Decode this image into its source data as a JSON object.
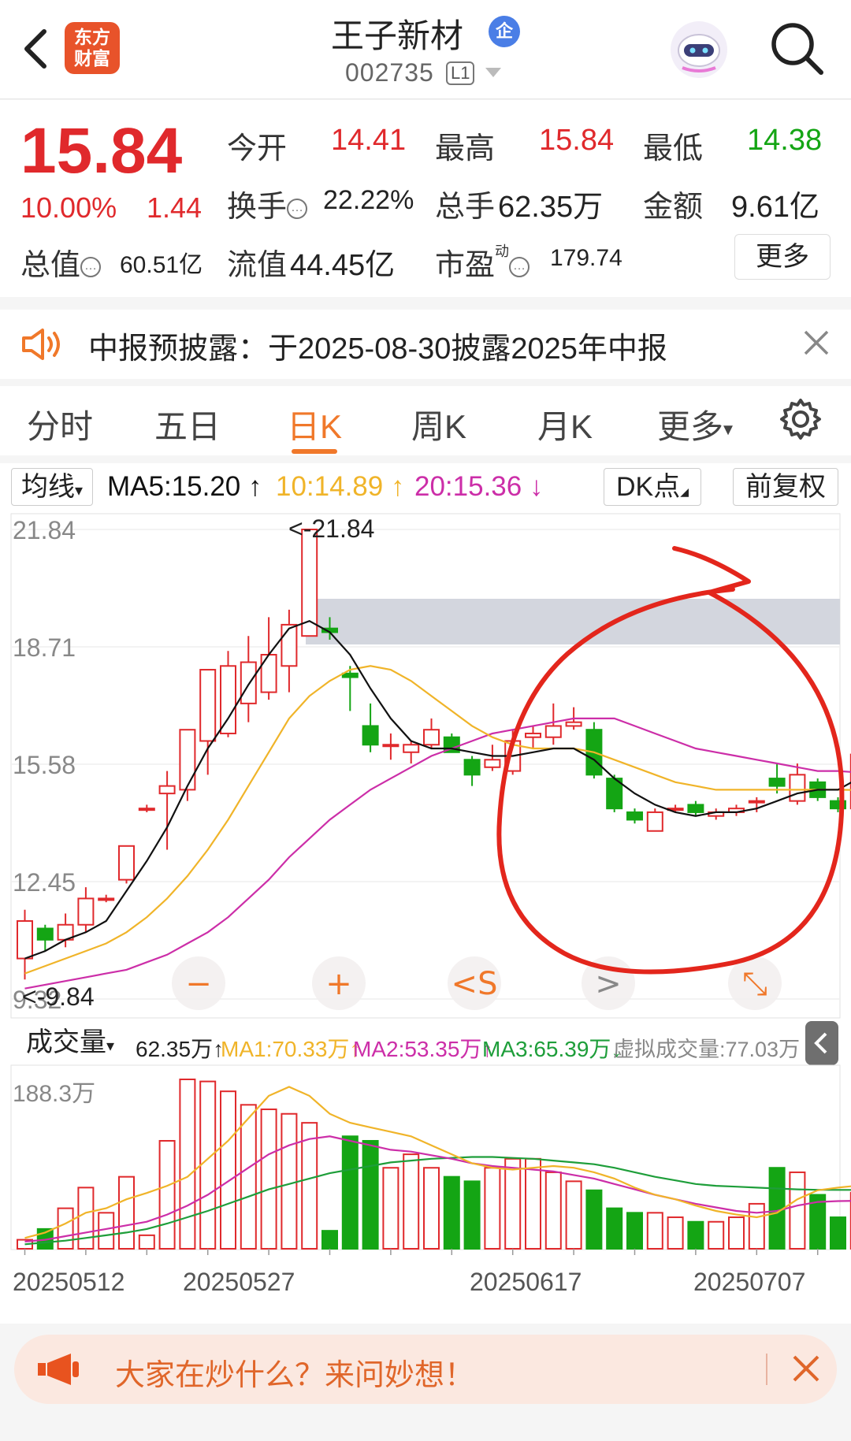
{
  "header": {
    "logo_line1": "东方",
    "logo_line2": "财富",
    "stock_name": "王子新材",
    "badge": "企",
    "stock_code": "002735",
    "level_badge": "L1"
  },
  "quote": {
    "price": "15.84",
    "change_pct": "10.00%",
    "change_amt": "1.44",
    "open_label": "今开",
    "open_value": "14.41",
    "high_label": "最高",
    "high_value": "15.84",
    "low_label": "最低",
    "low_value": "14.38",
    "turnover_label": "换手",
    "turnover_value": "22.22%",
    "volume_label": "总手",
    "volume_value": "62.35万",
    "amount_label": "金额",
    "amount_value": "9.61亿",
    "mcap_label": "总值",
    "mcap_value": "60.51亿",
    "float_label": "流值",
    "float_value": "44.45亿",
    "pe_label": "市盈",
    "pe_super": "动",
    "pe_value": "179.74",
    "more_button": "更多"
  },
  "notice": {
    "text": "中报预披露：于2025-08-30披露2025年中报"
  },
  "tabs": [
    "分时",
    "五日",
    "日K",
    "周K",
    "月K",
    "更多"
  ],
  "active_tab": "日K",
  "ma_bar": {
    "select_label": "均线",
    "ma5": "MA5:15.20",
    "ma10": "10:14.89",
    "ma20": "20:15.36",
    "dk_button": "DK点",
    "adjust_button": "前复权"
  },
  "volume_bar": {
    "select_label": "成交量",
    "vol": "62.35万",
    "ma1": "MA1:70.33万",
    "ma2": "MA2:53.35万",
    "ma3": "MA3:65.39万",
    "virtual": "虚拟成交量:77.03万"
  },
  "colors": {
    "up": "#e0292c",
    "down": "#14a514",
    "ma5": "#111111",
    "ma10": "#f0b429",
    "ma20": "#cc2ea8",
    "vol_ma3": "#1e9e3a",
    "accent": "#f0782a"
  },
  "chart_data": {
    "type": "candlestick",
    "y_ticks": [
      "21.84",
      "18.71",
      "15.58",
      "12.45",
      "9.32"
    ],
    "max_marker": "<-21.84",
    "min_marker": "<-9.84",
    "volume_max_label": "188.3万",
    "x_labels": [
      "20250512",
      "20250527",
      "20250617",
      "20250707"
    ],
    "candles": [
      {
        "o": 10.4,
        "c": 11.4,
        "h": 11.7,
        "l": 9.84
      },
      {
        "o": 11.2,
        "c": 10.9,
        "h": 11.3,
        "l": 10.6
      },
      {
        "o": 10.9,
        "c": 11.3,
        "h": 11.6,
        "l": 10.7
      },
      {
        "o": 11.3,
        "c": 12.0,
        "h": 12.3,
        "l": 11.1
      },
      {
        "o": 12.0,
        "c": 12.0,
        "h": 12.1,
        "l": 11.9
      },
      {
        "o": 12.5,
        "c": 13.4,
        "h": 13.4,
        "l": 12.4
      },
      {
        "o": 14.4,
        "c": 14.4,
        "h": 14.5,
        "l": 14.3
      },
      {
        "o": 14.8,
        "c": 15.0,
        "h": 15.4,
        "l": 13.3
      },
      {
        "o": 14.9,
        "c": 16.5,
        "h": 16.5,
        "l": 14.6
      },
      {
        "o": 16.2,
        "c": 18.1,
        "h": 18.1,
        "l": 15.3
      },
      {
        "o": 16.4,
        "c": 18.2,
        "h": 18.6,
        "l": 16.3
      },
      {
        "o": 17.2,
        "c": 18.3,
        "h": 19.0,
        "l": 16.7
      },
      {
        "o": 17.5,
        "c": 18.5,
        "h": 19.5,
        "l": 17.3
      },
      {
        "o": 18.2,
        "c": 19.3,
        "h": 19.7,
        "l": 17.5
      },
      {
        "o": 19.0,
        "c": 21.84,
        "h": 21.84,
        "l": 19.0
      },
      {
        "o": 19.2,
        "c": 19.1,
        "h": 19.5,
        "l": 18.9
      },
      {
        "o": 18.0,
        "c": 17.9,
        "h": 18.2,
        "l": 17.0
      },
      {
        "o": 16.6,
        "c": 16.1,
        "h": 17.2,
        "l": 15.9
      },
      {
        "o": 16.1,
        "c": 16.1,
        "h": 16.4,
        "l": 15.7
      },
      {
        "o": 15.9,
        "c": 16.1,
        "h": 16.2,
        "l": 15.6
      },
      {
        "o": 16.1,
        "c": 16.5,
        "h": 16.8,
        "l": 16.0
      },
      {
        "o": 16.3,
        "c": 15.9,
        "h": 16.4,
        "l": 15.9
      },
      {
        "o": 15.7,
        "c": 15.3,
        "h": 15.8,
        "l": 15.0
      },
      {
        "o": 15.5,
        "c": 15.7,
        "h": 16.1,
        "l": 15.4
      },
      {
        "o": 15.4,
        "c": 16.2,
        "h": 16.5,
        "l": 15.3
      },
      {
        "o": 16.3,
        "c": 16.4,
        "h": 16.6,
        "l": 16.0
      },
      {
        "o": 16.3,
        "c": 16.6,
        "h": 17.2,
        "l": 16.1
      },
      {
        "o": 16.6,
        "c": 16.7,
        "h": 17.1,
        "l": 16.5
      },
      {
        "o": 16.5,
        "c": 15.3,
        "h": 16.7,
        "l": 15.2
      },
      {
        "o": 15.2,
        "c": 14.4,
        "h": 15.3,
        "l": 14.3
      },
      {
        "o": 14.3,
        "c": 14.1,
        "h": 14.4,
        "l": 14.0
      },
      {
        "o": 13.8,
        "c": 14.3,
        "h": 14.4,
        "l": 13.8
      },
      {
        "o": 14.4,
        "c": 14.4,
        "h": 14.5,
        "l": 14.3
      },
      {
        "o": 14.5,
        "c": 14.3,
        "h": 14.6,
        "l": 14.2
      },
      {
        "o": 14.2,
        "c": 14.3,
        "h": 14.4,
        "l": 14.1
      },
      {
        "o": 14.3,
        "c": 14.4,
        "h": 14.5,
        "l": 14.2
      },
      {
        "o": 14.6,
        "c": 14.6,
        "h": 14.7,
        "l": 14.3
      },
      {
        "o": 15.2,
        "c": 15.0,
        "h": 15.6,
        "l": 14.8
      },
      {
        "o": 14.6,
        "c": 15.3,
        "h": 15.6,
        "l": 14.5
      },
      {
        "o": 15.1,
        "c": 14.7,
        "h": 15.2,
        "l": 14.6
      },
      {
        "o": 14.6,
        "c": 14.4,
        "h": 14.7,
        "l": 14.3
      },
      {
        "o": 14.4,
        "c": 15.84,
        "h": 15.84,
        "l": 14.38
      }
    ],
    "ma5": [
      10.4,
      10.6,
      10.9,
      11.1,
      11.4,
      12.2,
      13.0,
      13.9,
      15.0,
      16.0,
      16.8,
      17.7,
      18.5,
      19.2,
      19.4,
      19.1,
      18.5,
      17.6,
      16.8,
      16.2,
      16.0,
      16.0,
      15.9,
      15.8,
      15.8,
      15.9,
      16.0,
      16.0,
      15.7,
      15.2,
      14.8,
      14.5,
      14.3,
      14.2,
      14.3,
      14.3,
      14.4,
      14.6,
      14.8,
      14.9,
      14.9,
      15.2
    ],
    "ma10": [
      10.0,
      10.2,
      10.4,
      10.6,
      10.8,
      11.1,
      11.5,
      12.0,
      12.6,
      13.3,
      14.1,
      15.0,
      15.9,
      16.8,
      17.4,
      17.8,
      18.1,
      18.2,
      18.1,
      17.8,
      17.4,
      17.0,
      16.6,
      16.3,
      16.1,
      16.0,
      16.0,
      16.0,
      15.9,
      15.7,
      15.5,
      15.3,
      15.1,
      15.0,
      14.9,
      14.9,
      14.9,
      14.9,
      14.9,
      14.9,
      14.9,
      14.89
    ],
    "ma20": [
      9.6,
      9.7,
      9.8,
      9.9,
      10.0,
      10.1,
      10.3,
      10.5,
      10.8,
      11.1,
      11.5,
      12.0,
      12.5,
      13.1,
      13.6,
      14.1,
      14.5,
      14.9,
      15.2,
      15.5,
      15.8,
      16.0,
      16.2,
      16.4,
      16.5,
      16.6,
      16.7,
      16.8,
      16.8,
      16.8,
      16.6,
      16.4,
      16.2,
      16.0,
      15.9,
      15.8,
      15.7,
      15.6,
      15.5,
      15.4,
      15.4,
      15.36
    ],
    "volume": [
      10,
      22,
      45,
      68,
      40,
      80,
      15,
      120,
      188.3,
      186,
      175,
      160,
      155,
      150,
      140,
      20,
      125,
      120,
      90,
      105,
      90,
      80,
      75,
      90,
      100,
      100,
      85,
      75,
      65,
      45,
      40,
      40,
      35,
      30,
      30,
      35,
      50,
      90,
      85,
      60,
      35,
      62.35
    ],
    "vol_ma1": [
      12,
      18,
      28,
      40,
      45,
      55,
      62,
      70,
      80,
      100,
      120,
      145,
      170,
      180,
      170,
      150,
      140,
      135,
      130,
      125,
      115,
      105,
      95,
      90,
      88,
      90,
      92,
      90,
      85,
      78,
      68,
      60,
      55,
      48,
      42,
      38,
      35,
      40,
      55,
      65,
      68,
      70.33
    ],
    "vol_ma2": [
      8,
      10,
      14,
      18,
      22,
      26,
      30,
      38,
      48,
      60,
      75,
      90,
      105,
      115,
      122,
      125,
      120,
      115,
      110,
      108,
      104,
      100,
      95,
      92,
      90,
      88,
      86,
      82,
      78,
      72,
      66,
      60,
      55,
      50,
      46,
      42,
      40,
      42,
      48,
      52,
      53,
      53.35
    ],
    "vol_ma3": [
      5,
      7,
      9,
      12,
      15,
      18,
      22,
      28,
      35,
      42,
      50,
      58,
      66,
      72,
      78,
      84,
      88,
      92,
      96,
      98,
      100,
      101,
      102,
      102,
      101,
      100,
      98,
      96,
      94,
      90,
      85,
      80,
      76,
      72,
      70,
      69,
      68,
      67,
      66,
      65.5,
      65.4,
      65.39
    ]
  }
}
